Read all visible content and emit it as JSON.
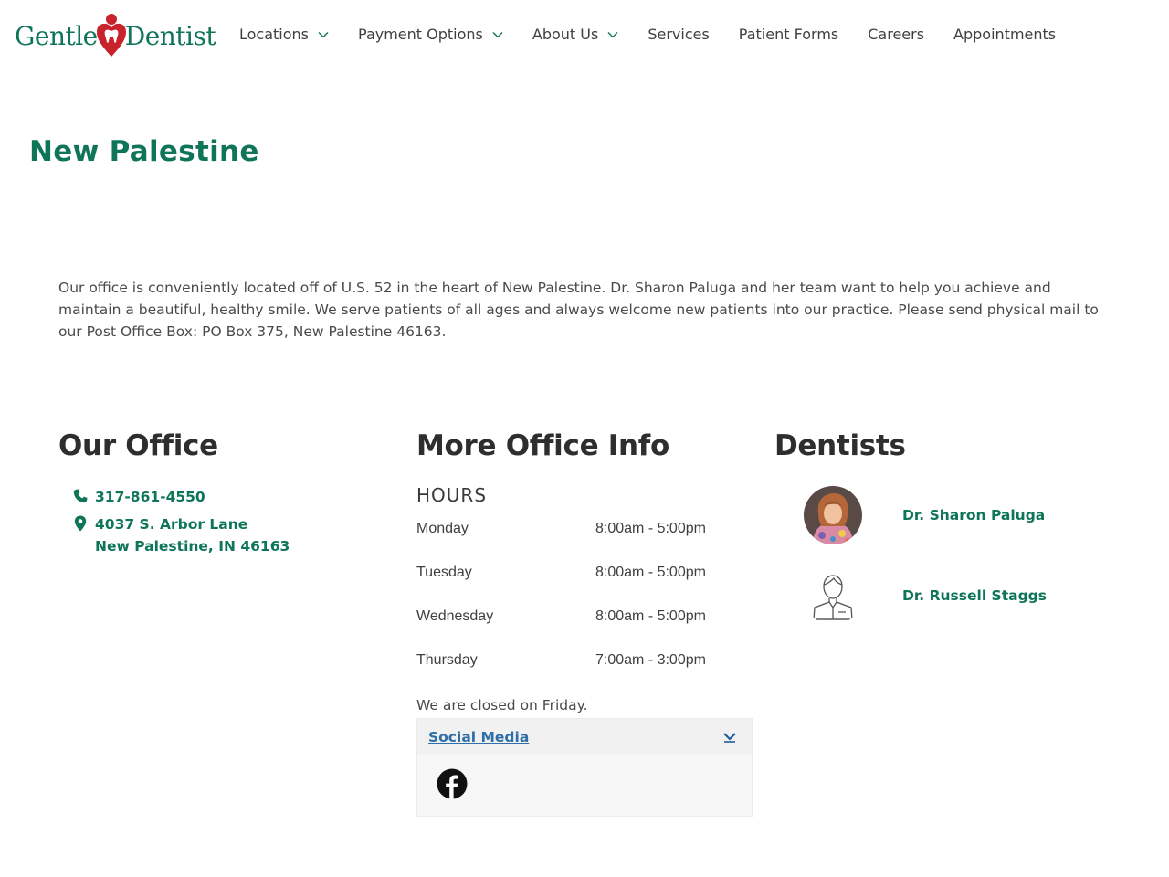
{
  "brand": {
    "left": "Gentle",
    "right": "Dentist",
    "color_primary": "#0f7558",
    "color_heart": "#c8232c"
  },
  "nav": [
    {
      "label": "Locations",
      "dropdown": true
    },
    {
      "label": "Payment Options",
      "dropdown": true
    },
    {
      "label": "About Us",
      "dropdown": true
    },
    {
      "label": "Services",
      "dropdown": false
    },
    {
      "label": "Patient Forms",
      "dropdown": false
    },
    {
      "label": "Careers",
      "dropdown": false
    },
    {
      "label": "Appointments",
      "dropdown": false
    }
  ],
  "page": {
    "title": "New Palestine",
    "intro": "Our office is conveniently located off of U.S. 52 in the heart of New Palestine. Dr. Sharon Paluga and her team want to help you achieve and maintain a beautiful, healthy smile. We serve patients of all ages and always welcome new patients into our practice. Please send physical mail to our Post Office Box: PO Box 375, New Palestine 46163."
  },
  "office": {
    "heading": "Our Office",
    "phone": "317-861-4550",
    "address_line1": "4037 S. Arbor Lane",
    "address_line2": "New Palestine, IN 46163"
  },
  "more_info": {
    "heading": "More Office Info",
    "hours_label": "HOURS",
    "hours": [
      {
        "day": "Monday",
        "time": "8:00am - 5:00pm"
      },
      {
        "day": "Tuesday",
        "time": "8:00am - 5:00pm"
      },
      {
        "day": "Wednesday",
        "time": "8:00am - 5:00pm"
      },
      {
        "day": "Thursday",
        "time": "7:00am - 3:00pm"
      }
    ],
    "closed_note": "We are closed on Friday.",
    "social_title": "Social Media",
    "social_icons": [
      "facebook-icon"
    ]
  },
  "dentists": {
    "heading": "Dentists",
    "list": [
      {
        "name": "Dr. Sharon Paluga",
        "avatar": "photo"
      },
      {
        "name": "Dr. Russell Staggs",
        "avatar": "placeholder-outline"
      }
    ]
  }
}
